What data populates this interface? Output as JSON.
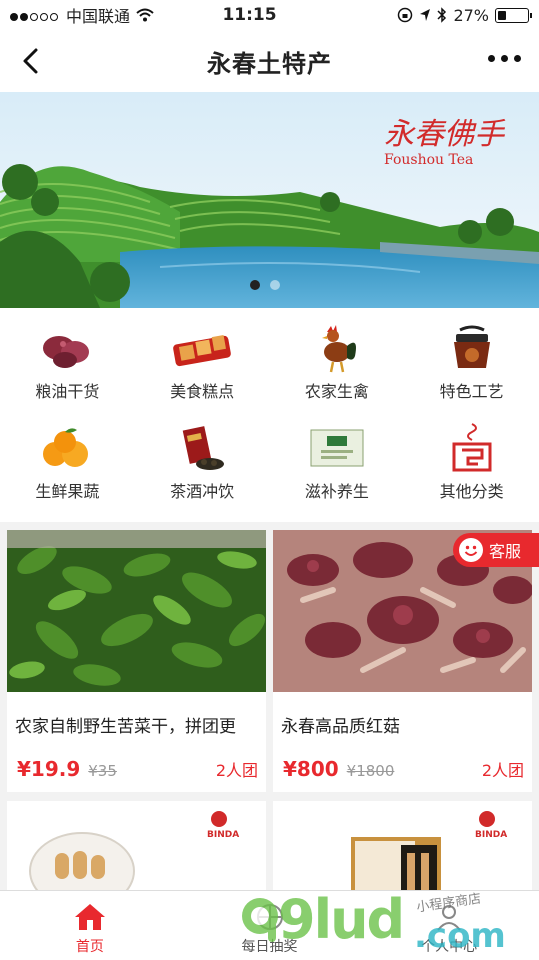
{
  "status_bar": {
    "carrier": "中国联通",
    "time": "11:15",
    "battery": "27%",
    "battery_level": 0.27
  },
  "nav": {
    "title": "永春土特产"
  },
  "banner": {
    "brand_cn": "永春佛手",
    "brand_en": "Foushou Tea",
    "active_slide": 0,
    "slide_count": 2
  },
  "categories": [
    {
      "label": "粮油干货",
      "icon": "dried-mushroom-icon"
    },
    {
      "label": "美食糕点",
      "icon": "pastry-icon"
    },
    {
      "label": "农家生禽",
      "icon": "rooster-icon"
    },
    {
      "label": "特色工艺",
      "icon": "craft-pot-icon"
    },
    {
      "label": "生鲜果蔬",
      "icon": "orange-fruit-icon"
    },
    {
      "label": "茶酒冲饮",
      "icon": "tea-pack-icon"
    },
    {
      "label": "滋补养生",
      "icon": "tonic-box-icon"
    },
    {
      "label": "其他分类",
      "icon": "other-pattern-icon"
    }
  ],
  "products": [
    {
      "name": "农家自制野生苦菜干，拼团更",
      "price": "¥19.9",
      "old_price": "¥35",
      "team": "2人团"
    },
    {
      "name": "永春高品质红菇",
      "price": "¥800",
      "old_price": "¥1800",
      "team": "2人团"
    }
  ],
  "products_partial": [
    {
      "brand": "BINDA"
    },
    {
      "brand": "BINDA"
    }
  ],
  "service": {
    "label": "客服"
  },
  "tabbar": [
    {
      "label": "首页",
      "active": true
    },
    {
      "label": "每日抽奖",
      "active": false
    },
    {
      "label": "个人中心",
      "active": false
    }
  ],
  "watermark": {
    "text": "9lud",
    "suffix": ".com",
    "tagline": "小程序商店"
  },
  "colors": {
    "accent": "#e8292e",
    "text": "#222222",
    "bg": "#f2f2f2"
  }
}
